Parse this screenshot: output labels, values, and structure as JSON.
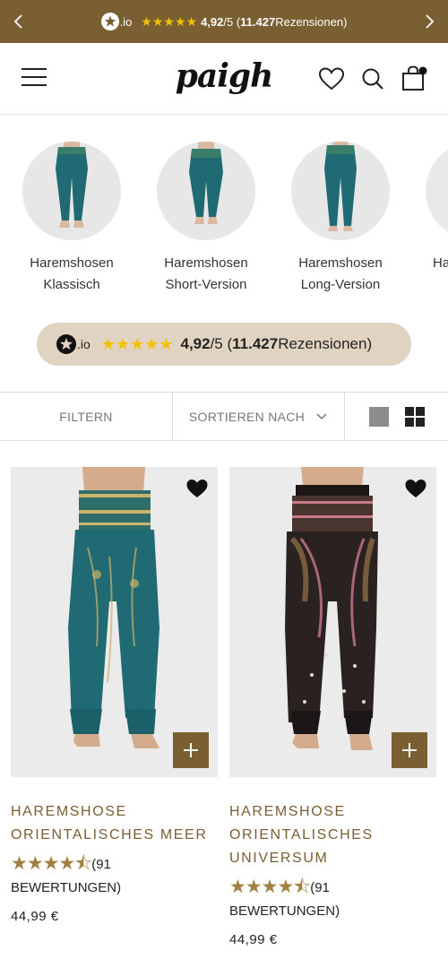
{
  "topbar": {
    "brand_suffix": ".io",
    "stars": "★★★★★",
    "score": "4,92",
    "score_suffix": "/5 (",
    "count": "11.427",
    "count_suffix": " Rezensionen)",
    "color": "#7a5f33",
    "icons": {
      "prev": "chevron-left-icon",
      "next": "chevron-right-icon"
    }
  },
  "header": {
    "logo": "paigh",
    "icons": [
      "menu-icon",
      "heart-icon",
      "search-icon",
      "shopping-bag-icon"
    ]
  },
  "categories": [
    {
      "line1": "Haremshosen",
      "line2": "Klassisch"
    },
    {
      "line1": "Haremshosen",
      "line2": "Short-Version"
    },
    {
      "line1": "Haremshosen",
      "line2": "Long-Version"
    },
    {
      "line1": "Ha",
      "line2": ""
    }
  ],
  "rating_pill": {
    "brand_suffix": ".io",
    "stars": "★★★★★",
    "score": "4,92",
    "score_suffix": "/5 (",
    "count": "11.427",
    "count_suffix": " Rezensionen)",
    "background": "#e0d3c2"
  },
  "filterbar": {
    "filter_label": "FILTERN",
    "sort_label": "SORTIEREN NACH",
    "view_icons": [
      "single-column-view-icon",
      "grid-view-icon"
    ]
  },
  "products": [
    {
      "title_line1": "HAREMSHOSE",
      "title_line2": "ORIENTALISCHES MEER",
      "stars": "★★★★⯪",
      "rating_value": 4.5,
      "reviews_prefix": "(91",
      "reviews_suffix": "BEWERTUNGEN)",
      "price": "44,99 €",
      "colors": {
        "fabric": "#1f6a73",
        "pattern": "#c9b46a"
      }
    },
    {
      "title_line1": "HAREMSHOSE",
      "title_line2": "ORIENTALISCHES",
      "title_line3": "UNIVERSUM",
      "stars": "★★★★⯪",
      "rating_value": 4.5,
      "reviews_prefix": "(91",
      "reviews_suffix": "BEWERTUNGEN)",
      "price": "44,99 €",
      "colors": {
        "fabric": "#2a2220",
        "pattern": "#c9788a"
      }
    }
  ],
  "accent_color": "#7a5f33"
}
